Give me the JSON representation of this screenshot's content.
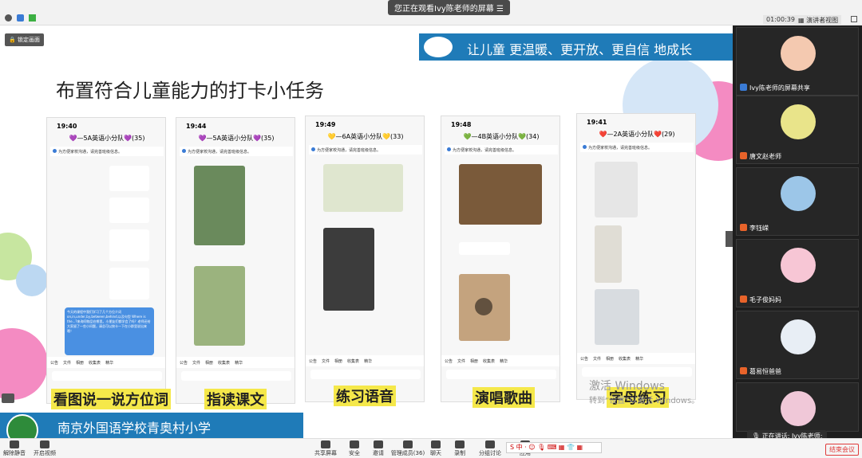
{
  "topbar": {
    "share_notice": "您正在观看Ivy陈老师的屏幕",
    "timer": "01:00:39",
    "view_mode": "演讲者视图"
  },
  "slide": {
    "lock_button": "锁定画面",
    "banner_slogan": "让儿童 更温暖、更开放、更自信 地成长",
    "title": "布置符合儿童能力的打卡小任务",
    "school_name": "南京外国语学校青奥村小学",
    "watermark_line1": "激活 Windows",
    "watermark_line2": "转到“设置”以激活 Windows。",
    "phones": [
      {
        "time": "19:40",
        "group": "💜—5A英语小分队💜(35)",
        "caption": "看图说一说方位词",
        "chat_text": "今天的课程中我们学习了几个方位介词on,in,under,by,between,behind,以及句型 Where is the...?来询问物品在哪里。小朋友们都学会了吗？老师还给大家留了一些小问题，请总可以按卡一下在小群里说出来哦！"
      },
      {
        "time": "19:44",
        "group": "💜—5A英语小分队💜(35)",
        "caption": "指读课文",
        "chat_text": ""
      },
      {
        "time": "19:49",
        "group": "💛—6A英语小分队💛(33)",
        "caption": "练习语音",
        "chat_text": ""
      },
      {
        "time": "19:48",
        "group": "💚—4B英语小分队💚(34)",
        "caption": "演唱歌曲",
        "chat_text": ""
      },
      {
        "time": "19:41",
        "group": "❤️—2A英语小分队❤️(29)",
        "caption": "字母练习",
        "chat_text": ""
      }
    ],
    "notice": "为方便家校沟通，请完善班级信息。",
    "toolbar": [
      "公告",
      "文件",
      "相册",
      "收集表",
      "精华"
    ]
  },
  "participants": [
    {
      "name": "Ivy陈老师的屏幕共享",
      "color": "#f4c9b0"
    },
    {
      "name": "唐文赵老师",
      "color": "#e9e48a"
    },
    {
      "name": "李钰嵘",
      "color": "#9cc6e8"
    },
    {
      "name": "毛子俊妈妈",
      "color": "#f7c6d5"
    },
    {
      "name": "葛易恒爸爸",
      "color": "#e8eef5"
    },
    {
      "name": "",
      "color": "#f0c8d8"
    }
  ],
  "speaking": "正在讲话: Ivy陈老师;",
  "bottom": {
    "mute": "解除静音",
    "video": "开启视频",
    "share": "共享屏幕",
    "security": "安全",
    "invite": "邀请",
    "members": "管理成员(36)",
    "chat": "聊天",
    "record": "录制",
    "breakout": "分组讨论",
    "apps": "应用",
    "end": "结束会议"
  },
  "colors": {
    "accent": "#e8632a",
    "banner": "#1f7bb8"
  }
}
